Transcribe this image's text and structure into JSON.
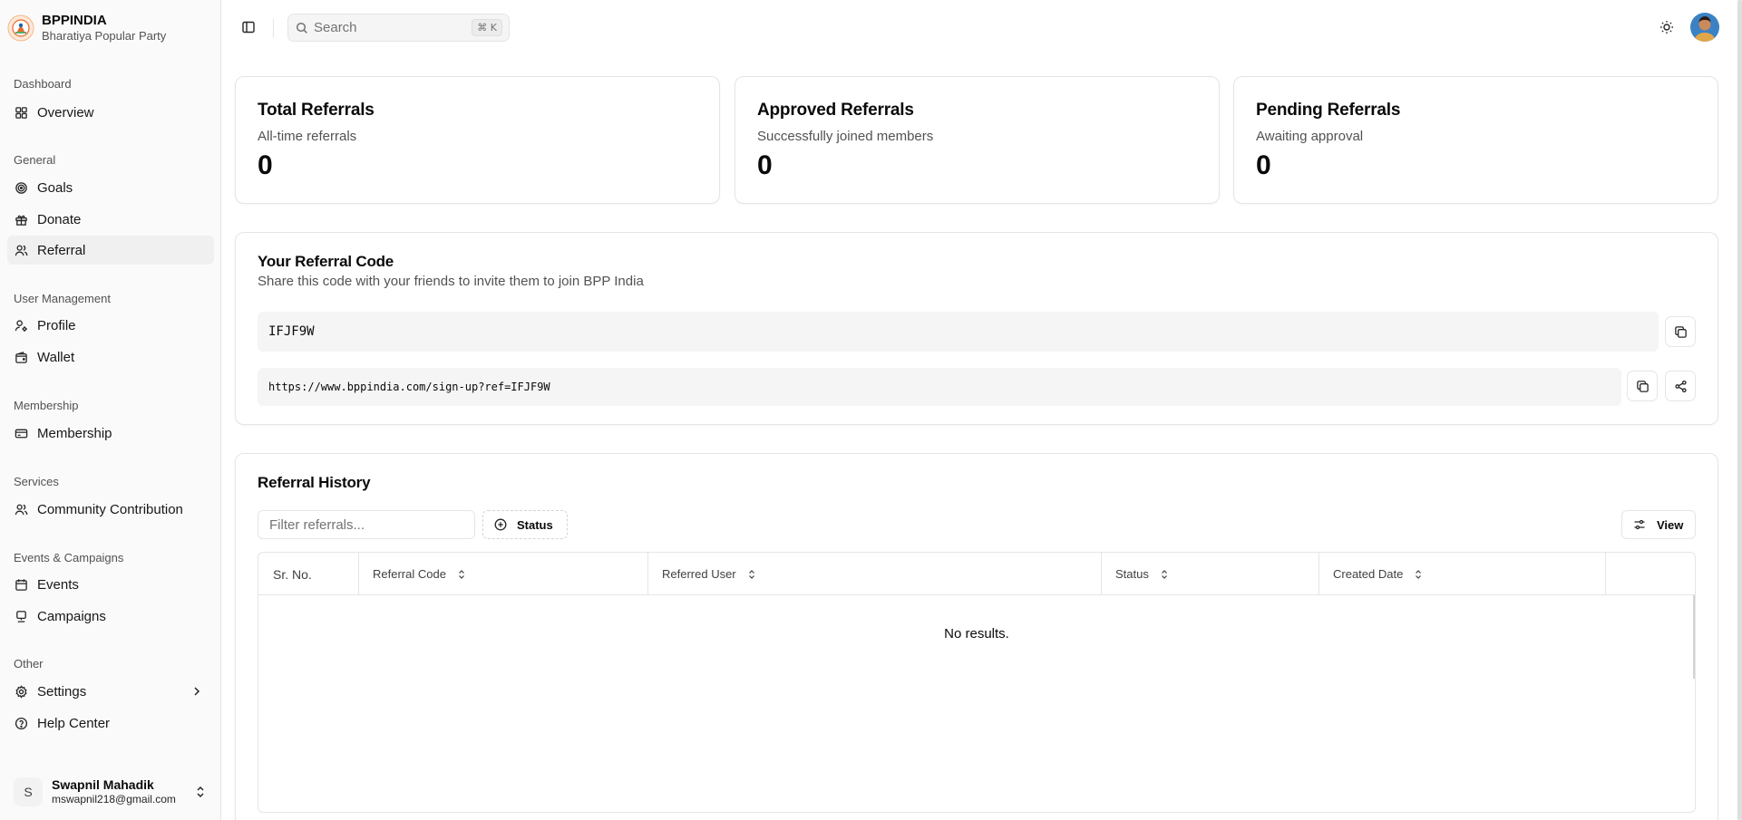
{
  "brand": {
    "name": "BPPINDIA",
    "subtitle": "Bharatiya Popular Party"
  },
  "sidebar": {
    "groups": [
      {
        "label": "Dashboard"
      },
      {
        "label": "General"
      },
      {
        "label": "User Management"
      },
      {
        "label": "Membership"
      },
      {
        "label": "Services"
      },
      {
        "label": "Events & Campaigns"
      },
      {
        "label": "Other"
      }
    ],
    "items": [
      {
        "label": "Overview",
        "icon": "grid-icon"
      },
      {
        "label": "Goals",
        "icon": "target-icon"
      },
      {
        "label": "Donate",
        "icon": "gift-icon"
      },
      {
        "label": "Referral",
        "icon": "users-icon",
        "active": true
      },
      {
        "label": "Profile",
        "icon": "user-cog-icon"
      },
      {
        "label": "Wallet",
        "icon": "wallet-icon"
      },
      {
        "label": "Membership",
        "icon": "card-icon"
      },
      {
        "label": "Community Contribution",
        "icon": "users-icon"
      },
      {
        "label": "Events",
        "icon": "calendar-icon"
      },
      {
        "label": "Campaigns",
        "icon": "monitor-icon"
      },
      {
        "label": "Settings",
        "icon": "gear-icon"
      },
      {
        "label": "Help Center",
        "icon": "help-circle-icon"
      }
    ]
  },
  "user": {
    "initial": "S",
    "name": "Swapnil Mahadik",
    "email": "mswapnil218@gmail.com"
  },
  "header": {
    "search_placeholder": "Search",
    "shortcut": "⌘ K"
  },
  "stats": [
    {
      "title": "Total Referrals",
      "subtitle": "All-time referrals",
      "value": "0"
    },
    {
      "title": "Approved Referrals",
      "subtitle": "Successfully joined members",
      "value": "0"
    },
    {
      "title": "Pending Referrals",
      "subtitle": "Awaiting approval",
      "value": "0"
    }
  ],
  "referral_code": {
    "title": "Your Referral Code",
    "subtitle": "Share this code with your friends to invite them to join BPP India",
    "code": "IFJF9W",
    "link": "https://www.bppindia.com/sign-up?ref=IFJF9W"
  },
  "history": {
    "title": "Referral History",
    "filter_placeholder": "Filter referrals...",
    "status_filter_label": "Status",
    "view_label": "View",
    "columns": [
      "Sr. No.",
      "Referral Code",
      "Referred User",
      "Status",
      "Created Date"
    ],
    "empty_text": "No results."
  },
  "colors": {
    "accent": "#0a0a0a",
    "muted": "#525252",
    "border": "#e5e5e5",
    "sidebar_bg": "#fafafa"
  }
}
